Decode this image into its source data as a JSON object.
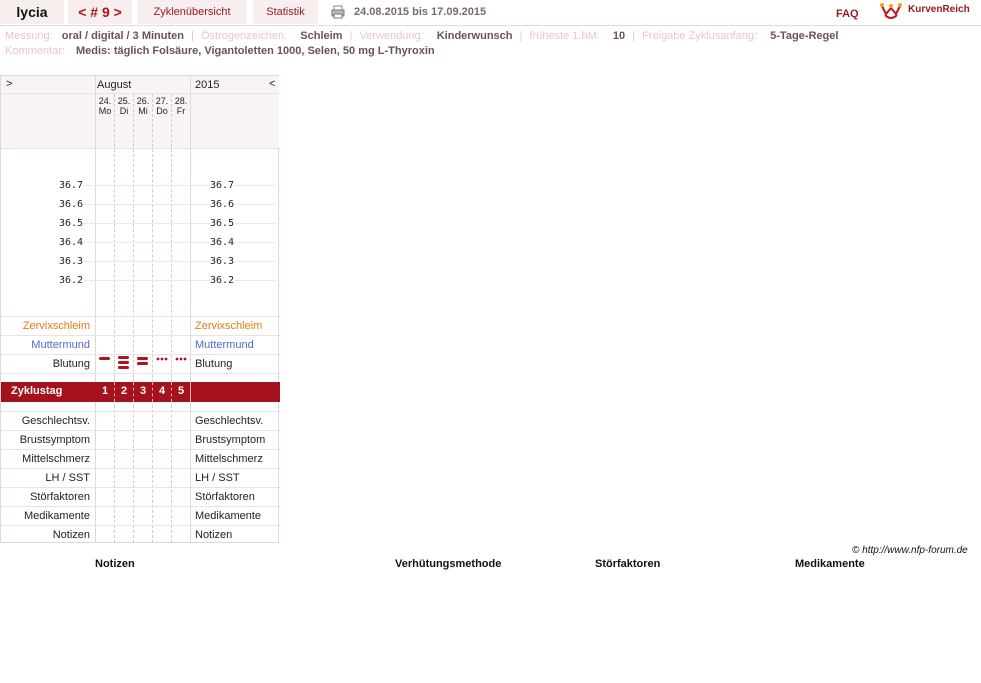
{
  "nav": {
    "user": "lycia",
    "cycle": "< # 9 >",
    "overview": "Zyklenübersicht",
    "stats": "Statistik",
    "date_range": "24.08.2015 bis 17.09.2015",
    "faq": "FAQ",
    "brand": "KurvenReich"
  },
  "info": {
    "messung_label": "Messung:",
    "messung_value": "oral / digital / 3 Minuten",
    "oestrogen_label": "Östrogenzeichen:",
    "oestrogen_value": "Schleim",
    "verwendung_label": "Verwendung:",
    "verwendung_value": "Kinderwunsch",
    "hm_label": "früheste 1.hM:",
    "hm_value": "10",
    "freigabe_label": "Freigabe Zyklusanfang:",
    "freigabe_value": "5-Tage-Regel",
    "kommentar_label": "Kommentar:",
    "kommentar_value": "Medis: täglich Folsäure, Vigantoletten 1000, Selen, 50 mg L-Thyroxin"
  },
  "chart": {
    "nav_prev": ">",
    "nav_next": "<",
    "month": "August",
    "year": "2015",
    "days": [
      {
        "date": "24.",
        "dow": "Mo"
      },
      {
        "date": "25.",
        "dow": "Di"
      },
      {
        "date": "26.",
        "dow": "Mi"
      },
      {
        "date": "27.",
        "dow": "Do"
      },
      {
        "date": "28.",
        "dow": "Fr"
      }
    ],
    "temps": [
      "36.7",
      "36.6",
      "36.5",
      "36.4",
      "36.3",
      "36.2"
    ],
    "rows": {
      "zervix": "Zervixschleim",
      "muttermund": "Muttermund",
      "blutung": "Blutung",
      "zyklustag": "Zyklustag",
      "geschlechtsv": "Geschlechtsv.",
      "brust": "Brustsymptom",
      "mittel": "Mittelschmerz",
      "lh": "LH / SST",
      "stoer": "Störfaktoren",
      "medi": "Medikamente",
      "notizen": "Notizen"
    },
    "zyklustage": [
      "1",
      "2",
      "3",
      "4",
      "5"
    ],
    "bleeding": [
      "heavy",
      "very-heavy",
      "heavy-double",
      "spotting",
      "spotting"
    ]
  },
  "colors": {
    "accent": "#a5111c",
    "zervix": "#e07b12",
    "muttermund": "#5566c8"
  },
  "footer": {
    "link": "© http://www.nfp-forum.de",
    "col_notizen": "Notizen",
    "col_verhuetung": "Verhütungsmethode",
    "col_stoer": "Störfaktoren",
    "col_medi": "Medikamente"
  }
}
